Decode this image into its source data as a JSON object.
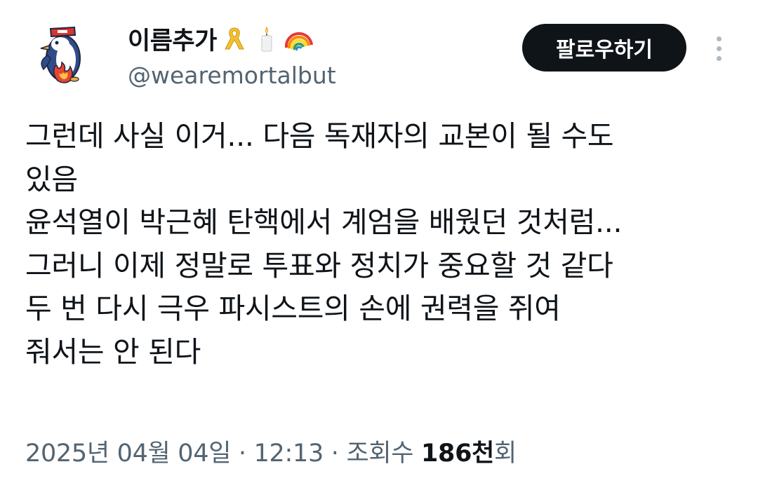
{
  "user": {
    "display_name": "이름추가",
    "handle": "@wearemortalbut",
    "name_emojis": [
      "yellow-ribbon-icon",
      "candle-icon",
      "rainbow-icon"
    ],
    "avatar": "penguin-avatar"
  },
  "actions": {
    "follow_label": "팔로우하기",
    "more_icon": "more-vertical-icon"
  },
  "tweet": {
    "lines": [
      "그런데 사실 이거... 다음 독재자의 교본이 될 수도",
      "있음",
      "윤석열이 박근혜 탄핵에서 계엄을 배웠던 것처럼...",
      "그러니 이제 정말로 투표와 정치가 중요할 것 같다",
      "두 번 다시 극우 파시스트의 손에 권력을 쥐여",
      "줘서는 안 된다"
    ]
  },
  "meta": {
    "date": "2025년 04월 04일",
    "separator": " · ",
    "time": "12:13",
    "views_label": "조회수 ",
    "views_count": "186천",
    "views_suffix": "회"
  },
  "colors": {
    "text_primary": "#0f1419",
    "text_secondary": "#536471",
    "follow_bg": "#0f1419",
    "follow_text": "#ffffff"
  }
}
